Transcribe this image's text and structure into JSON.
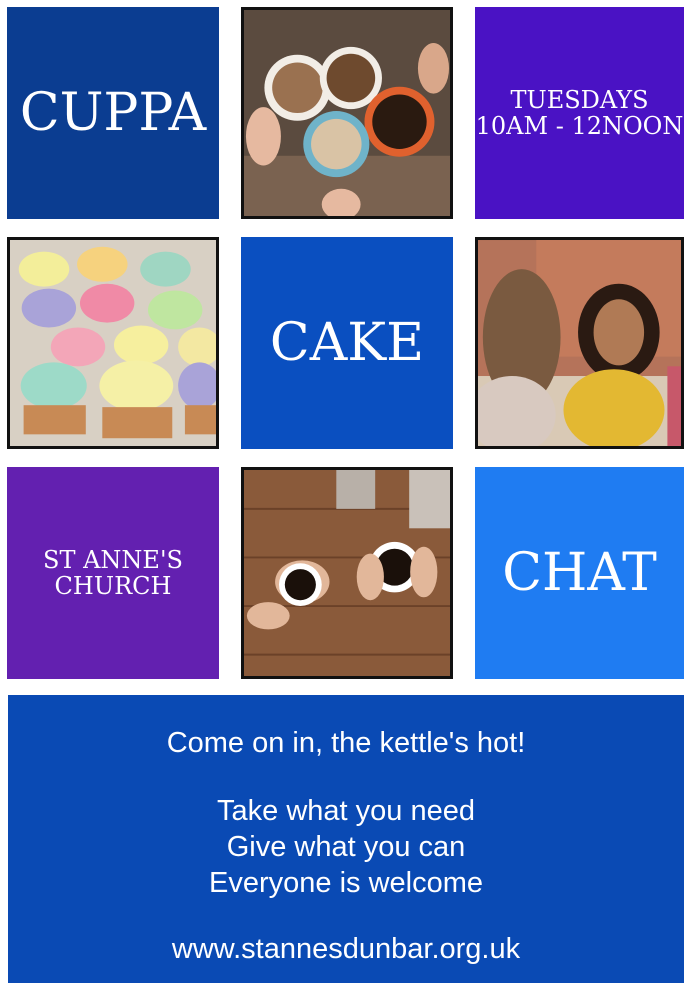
{
  "tiles": {
    "cuppa": "CUPPA",
    "tuesdays": "TUESDAYS",
    "time": "10AM - 12NOON",
    "cake": "CAKE",
    "church_line1": "ST ANNE'S",
    "church_line2": "CHURCH",
    "chat": "CHAT"
  },
  "footer": {
    "tagline": "Come on in, the kettle's hot!",
    "line1": "Take  what you need",
    "line2": "Give what you can",
    "line3": "Everyone is welcome",
    "url": "www.stannesdunbar.org.uk"
  },
  "colors": {
    "navy": "#0b3d91",
    "violet": "#4a12c4",
    "royal": "#0a4fc0",
    "purple": "#6320b0",
    "sky": "#1f7cf2",
    "footer": "#0a4ab4"
  },
  "images": [
    "coffee-cups-photo",
    "cupcakes-photo",
    "women-chatting-photo",
    "hands-coffee-photo"
  ]
}
